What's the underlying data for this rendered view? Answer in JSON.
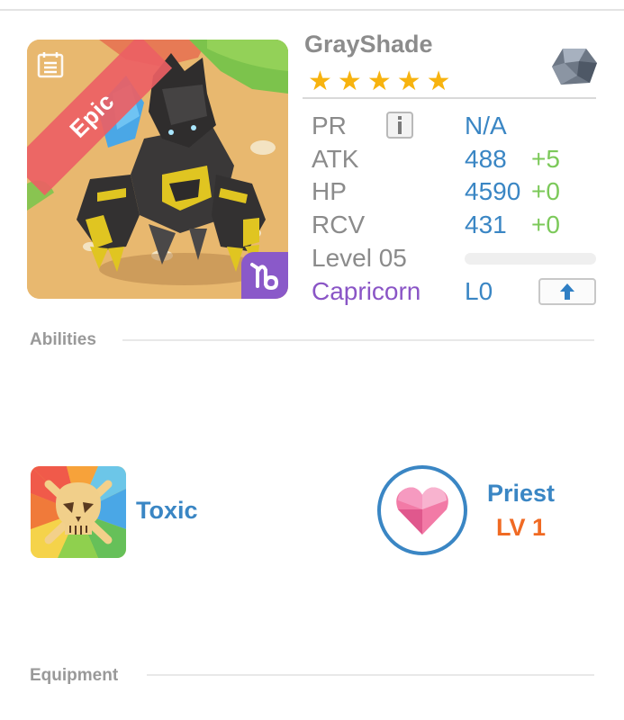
{
  "monster": {
    "name": "GrayShade",
    "rarity": "Epic",
    "stars": 5,
    "star_glyph": "★",
    "element_icon": "stone-element-icon",
    "portrait_icon": "armored-beetle-monster",
    "zodiac_symbol": "♑"
  },
  "stats": {
    "pr_label": "PR",
    "pr_value": "N/A",
    "atk_label": "ATK",
    "atk_value": "488",
    "atk_bonus": "+5",
    "hp_label": "HP",
    "hp_value": "4590",
    "hp_bonus": "+0",
    "rcv_label": "RCV",
    "rcv_value": "431",
    "rcv_bonus": "+0",
    "level_label": "Level 05",
    "level_progress": 0,
    "sign_name": "Capricorn",
    "sign_level": "L0"
  },
  "sections": {
    "abilities_title": "Abilities",
    "equipment_title": "Equipment"
  },
  "abilities": {
    "ability_name": "Toxic",
    "ability_icon": "toxic-skull-icon",
    "class_name": "Priest",
    "class_level": "LV 1",
    "class_icon": "heart-icon"
  },
  "colors": {
    "accent_blue": "#3a86c4",
    "bonus_green": "#7cc95a",
    "epic_red": "#ec5f64",
    "capricorn_purple": "#8a55c6",
    "class_level_orange": "#f06a23",
    "star_gold": "#f7b30f"
  }
}
